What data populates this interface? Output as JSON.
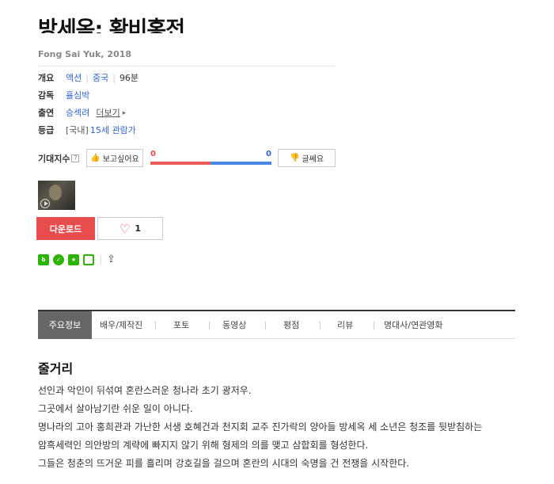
{
  "movie": {
    "title": "방세옥: 황비홍전",
    "subtitle": "Fong Sai Yuk, 2018"
  },
  "info": {
    "overview_key": "개요",
    "genre": "액션",
    "country": "중국",
    "runtime": "96분",
    "director_key": "감독",
    "director": "휼심박",
    "cast_key": "출연",
    "cast": "승섹려",
    "more": "더보기",
    "rating_key": "등급",
    "rating_domestic": "[국내]",
    "rating": "15세 관람가"
  },
  "expectation": {
    "label": "기대지수",
    "help": "?",
    "want_button": "보고싶어요",
    "want_count": "0",
    "nope_button": "글쎄요",
    "nope_count": "0",
    "colors": {
      "want": "#ef5a5a",
      "nope": "#4a86e8"
    }
  },
  "actions": {
    "download": "다운로드",
    "like_count": "1"
  },
  "share": {
    "icons": [
      "blog-icon",
      "line-icon",
      "bookmark-star-icon",
      "share-square-icon",
      "share-icon"
    ]
  },
  "tabs": [
    {
      "label": "주요정보"
    },
    {
      "label": "배우/제작진"
    },
    {
      "label": "포토"
    },
    {
      "label": "동영상"
    },
    {
      "label": "평점"
    },
    {
      "label": "리뷰"
    },
    {
      "label": "명대사/연관영화"
    }
  ],
  "synopsis": {
    "heading": "줄거리",
    "lines": [
      "선인과 악인이 뒤섞여 혼란스러운 청나라 초기 광저우.",
      " 그곳에서 살아남기란 쉬운 일이 아니다.",
      " 명나라의 고아 홍희관과 가난한 서생 호혜건과 천지회 교주 진가락의 양아들 방세옥 세 소년은 청조를 뒷받침하는",
      "암흑세력인 의안방의 계략에 빠지지 않기 위해 형제의 의를 맺고 삼합회를 형성한다.",
      " 그들은 청춘의 뜨거운 피를 흘리며 강호길을 걸으며 혼란의 시대의 숙명을 건 전쟁을 시작한다."
    ]
  }
}
